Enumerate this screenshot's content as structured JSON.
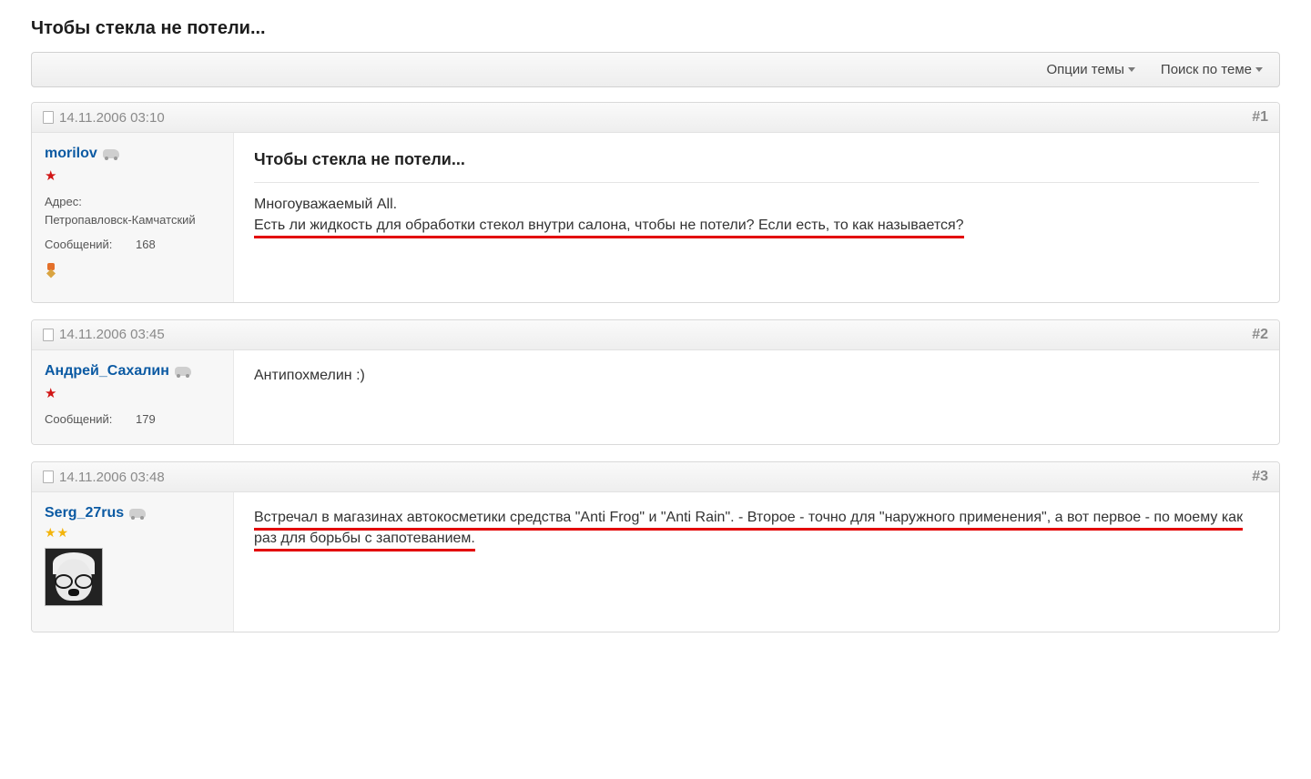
{
  "thread": {
    "title": "Чтобы стекла не потели..."
  },
  "toolbar": {
    "options": "Опции темы",
    "search": "Поиск по теме"
  },
  "labels": {
    "address": "Адрес:",
    "messages": "Сообщений:"
  },
  "posts": [
    {
      "datetime": "14.11.2006 03:10",
      "number": "#1",
      "user": {
        "name": "morilov",
        "has_car_icon": true,
        "red_stars": 1,
        "yellow_stars": 0,
        "address": "Петропавловск-Камчатский",
        "messages": "168",
        "has_medal": true,
        "has_avatar": false
      },
      "subject": "Чтобы стекла не потели...",
      "body_pre": "Многоуважаемый All.",
      "body_main": "Есть ли жидкость для обработки стекол внутри салона, чтобы не потели? Если есть, то как называется?",
      "underline": true
    },
    {
      "datetime": "14.11.2006 03:45",
      "number": "#2",
      "user": {
        "name": "Андрей_Сахалин",
        "has_car_icon": true,
        "red_stars": 1,
        "yellow_stars": 0,
        "address": "",
        "messages": "179",
        "has_medal": false,
        "has_avatar": false
      },
      "subject": "",
      "body_pre": "",
      "body_main": "Антипохмелин :)",
      "underline": false
    },
    {
      "datetime": "14.11.2006 03:48",
      "number": "#3",
      "user": {
        "name": "Serg_27rus",
        "has_car_icon": true,
        "red_stars": 0,
        "yellow_stars": 2,
        "address": "",
        "messages": "",
        "has_medal": false,
        "has_avatar": true
      },
      "subject": "",
      "body_pre": "",
      "body_main": "Встречал в магазинах автокосметики средства \"Anti Frog\" и \"Anti Rain\". - Второе - точно для \"наружного применения\", а вот первое - по моему как раз для борьбы с запотеванием.",
      "underline": true
    }
  ]
}
